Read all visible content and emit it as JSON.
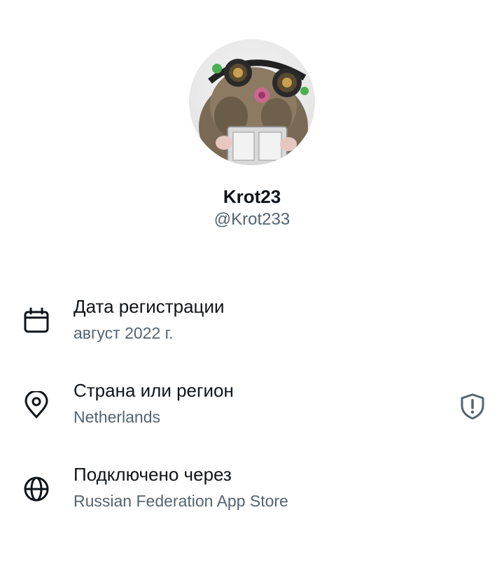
{
  "profile": {
    "display_name": "Krot23",
    "handle": "@Krot233",
    "avatar_icon": "mole-with-goggles-avatar"
  },
  "about": {
    "items": [
      {
        "icon": "calendar-icon",
        "title": "Дата регистрации",
        "value": "август 2022 г."
      },
      {
        "icon": "location-pin-icon",
        "title": "Страна или регион",
        "value": "Netherlands",
        "trailing_icon": "shield-alert-icon"
      },
      {
        "icon": "globe-icon",
        "title": "Подключено через",
        "value": "Russian Federation App Store"
      }
    ]
  },
  "colors": {
    "primary_text": "#0f1419",
    "secondary_text": "#536471",
    "background": "#ffffff"
  }
}
